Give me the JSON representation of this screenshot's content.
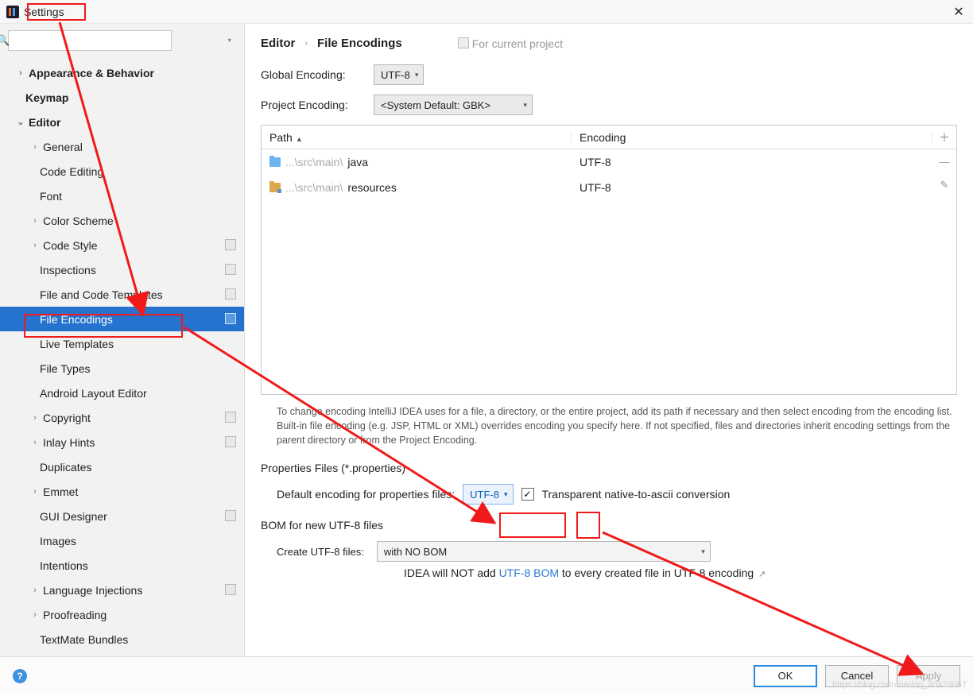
{
  "window": {
    "title": "Settings"
  },
  "sidebar": {
    "search_placeholder": "",
    "items": [
      {
        "label": "Appearance & Behavior",
        "level": 0,
        "chev": ">",
        "bold": true
      },
      {
        "label": "Keymap",
        "level": 0,
        "chev": "",
        "bold": true
      },
      {
        "label": "Editor",
        "level": 0,
        "chev": "v",
        "bold": true
      },
      {
        "label": "General",
        "level": 1,
        "chev": ">"
      },
      {
        "label": "Code Editing",
        "level": 1,
        "chev": ""
      },
      {
        "label": "Font",
        "level": 1,
        "chev": ""
      },
      {
        "label": "Color Scheme",
        "level": 1,
        "chev": ">"
      },
      {
        "label": "Code Style",
        "level": 1,
        "chev": ">",
        "copy": true
      },
      {
        "label": "Inspections",
        "level": 1,
        "chev": "",
        "copy": true
      },
      {
        "label": "File and Code Templates",
        "level": 1,
        "chev": "",
        "copy": true
      },
      {
        "label": "File Encodings",
        "level": 1,
        "chev": "",
        "copy": true,
        "selected": true
      },
      {
        "label": "Live Templates",
        "level": 1,
        "chev": ""
      },
      {
        "label": "File Types",
        "level": 1,
        "chev": ""
      },
      {
        "label": "Android Layout Editor",
        "level": 1,
        "chev": ""
      },
      {
        "label": "Copyright",
        "level": 1,
        "chev": ">",
        "copy": true
      },
      {
        "label": "Inlay Hints",
        "level": 1,
        "chev": ">",
        "copy": true
      },
      {
        "label": "Duplicates",
        "level": 1,
        "chev": ""
      },
      {
        "label": "Emmet",
        "level": 1,
        "chev": ">"
      },
      {
        "label": "GUI Designer",
        "level": 1,
        "chev": "",
        "copy": true
      },
      {
        "label": "Images",
        "level": 1,
        "chev": ""
      },
      {
        "label": "Intentions",
        "level": 1,
        "chev": ""
      },
      {
        "label": "Language Injections",
        "level": 1,
        "chev": ">",
        "copy": true
      },
      {
        "label": "Proofreading",
        "level": 1,
        "chev": ">"
      },
      {
        "label": "TextMate Bundles",
        "level": 1,
        "chev": ""
      }
    ]
  },
  "breadcrumb": {
    "item0": "Editor",
    "item1": "File Encodings",
    "meta": "For current project"
  },
  "globals": {
    "global_label": "Global Encoding:",
    "global_value": "UTF-8",
    "project_label": "Project Encoding:",
    "project_value": "<System Default: GBK>"
  },
  "table": {
    "col_path": "Path",
    "col_enc": "Encoding",
    "rows": [
      {
        "icon": "folder",
        "path_dim": "...\\src\\main\\",
        "path_tail": "java",
        "enc": "UTF-8"
      },
      {
        "icon": "res",
        "path_dim": "...\\src\\main\\",
        "path_tail": "resources",
        "enc": "UTF-8"
      }
    ]
  },
  "help": "To change encoding IntelliJ IDEA uses for a file, a directory, or the entire project, add its path if necessary and then select encoding from the encoding list. Built-in file encoding (e.g. JSP, HTML or XML) overrides encoding you specify here. If not specified, files and directories inherit encoding settings from the parent directory or from the Project Encoding.",
  "props": {
    "heading": "Properties Files (*.properties)",
    "label": "Default encoding for properties files:",
    "value": "UTF-8",
    "chk_label": "Transparent native-to-ascii conversion",
    "chk_checked": true
  },
  "bom": {
    "heading": "BOM for new UTF-8 files",
    "label": "Create UTF-8 files:",
    "value": "with NO BOM",
    "note_pre": "IDEA will NOT add ",
    "note_link": "UTF-8 BOM",
    "note_post": " to every created file in UTF-8 encoding"
  },
  "footer": {
    "ok": "OK",
    "cancel": "Cancel",
    "apply": "Apply"
  },
  "watermark": "https://blog.csdn.net/qq_40429067"
}
